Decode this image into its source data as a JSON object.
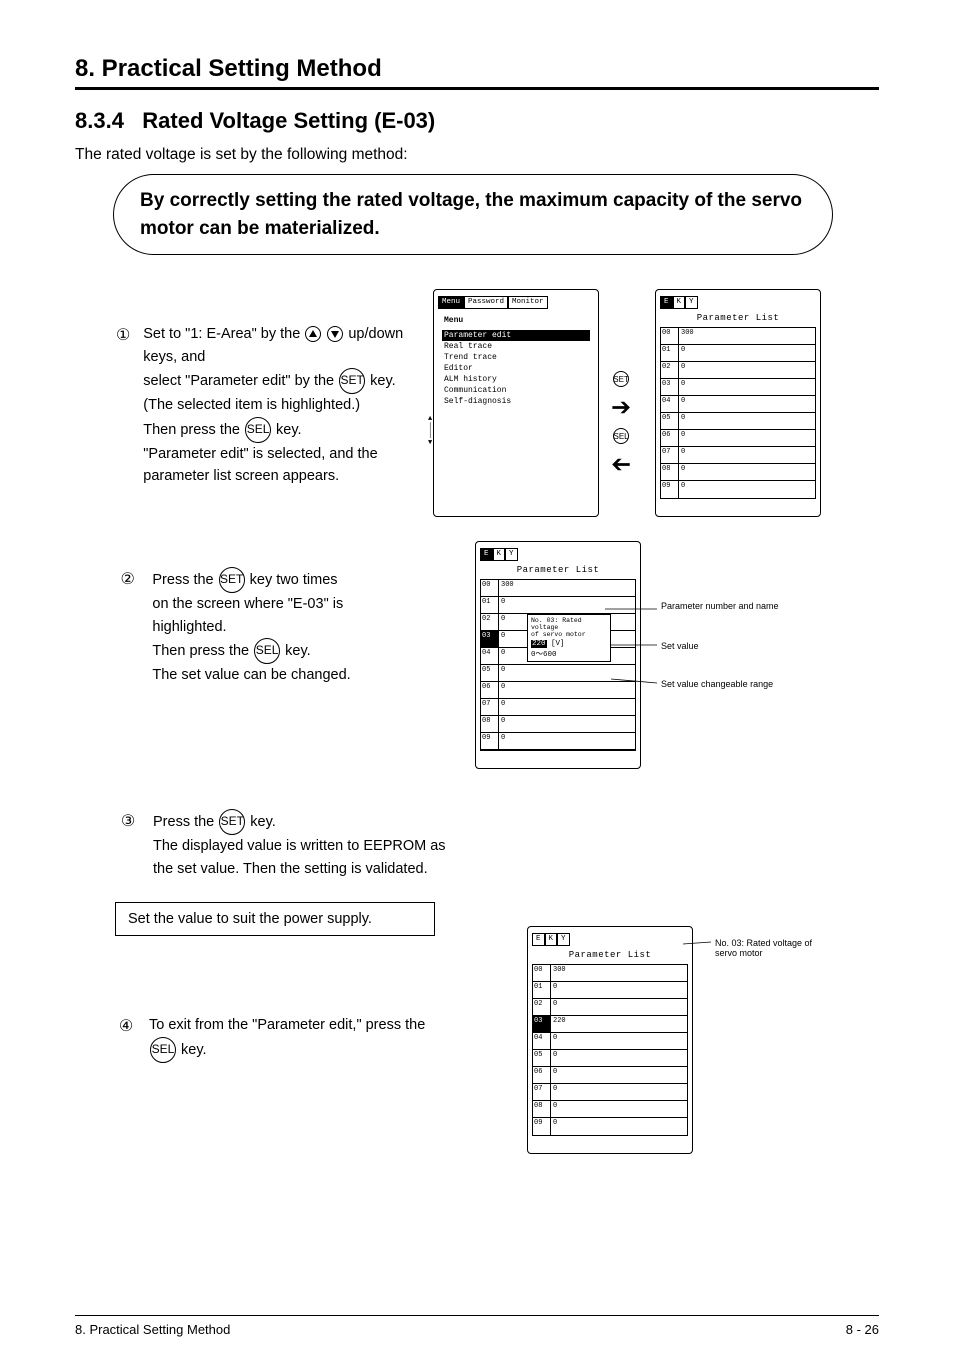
{
  "header": {
    "chapter": "8. Practical Setting Method"
  },
  "title": {
    "section_no": "8.3.4",
    "section_name": "Rated Voltage Setting (E-03)"
  },
  "intro": "The rated voltage is set by the following method:",
  "purpose": "By correctly setting the rated voltage, the maximum capacity of the servo motor can be materialized.",
  "steps": {
    "s1": {
      "line1": "Set to \"1: E-Area\" by the",
      "line2": "select \"Parameter edit\" by the",
      "line3": "(The selected item is highlighted.)",
      "line4": "Then press the",
      "line5": "\"Parameter edit\" is selected, and the parameter list screen appears.",
      "up_down_a11y": "up/down keys, and",
      "key_set_label": "SET",
      "key_sel_label": "SEL"
    },
    "s2": {
      "line1": "Press the",
      "line2": "on the screen where \"E-03\" is highlighted.",
      "line3": "Then press the",
      "line4": "The set value can be changed.",
      "key_set_label": "SET",
      "key_sel_label": "SEL"
    },
    "s3": {
      "line1": "Press the",
      "line2": "The displayed value is written to EEPROM as the set value. Then the setting is validated.",
      "key_set_label": "SET"
    },
    "note": "Set the value to suit the power supply.",
    "s4": {
      "line1": "To exit from the \"Parameter edit,\" press the",
      "key_sel_label": "SEL"
    }
  },
  "screens": {
    "menu": {
      "tabs": [
        "Menu",
        "Password",
        "Monitor"
      ],
      "title": "Menu",
      "items": [
        "Parameter edit",
        "Real trace",
        "Trend trace",
        "Editor",
        "ALM history",
        "Communication",
        "Self-diagnosis"
      ],
      "sel_index": 0
    },
    "list_a": {
      "rows": [
        {
          "a": "00",
          "b": "300"
        },
        {
          "a": "01",
          "b": "0"
        },
        {
          "a": "02",
          "b": "0"
        },
        {
          "a": "03",
          "b": "0"
        },
        {
          "a": "04",
          "b": "0"
        },
        {
          "a": "05",
          "b": "0"
        },
        {
          "a": "06",
          "b": "0"
        },
        {
          "a": "07",
          "b": "0"
        },
        {
          "a": "08",
          "b": "0"
        },
        {
          "a": "09",
          "b": "0"
        }
      ]
    },
    "editor": {
      "title_lines": [
        "No. 03: Rated voltage",
        "of servo motor"
      ],
      "value_sel": "220",
      "value_label": "[V]",
      "range": "0～600",
      "annot_label": "Parameter number and name",
      "annot_setval": "Set value",
      "annot_range": "Set value changeable range"
    },
    "exit": {
      "annot_name": "No. 03: Rated voltage of servo motor"
    }
  },
  "circle_keys": {
    "set": "SET",
    "sel": "SEL"
  },
  "footer": {
    "left": "8. Practical Setting Method",
    "right": "8 - 26"
  }
}
